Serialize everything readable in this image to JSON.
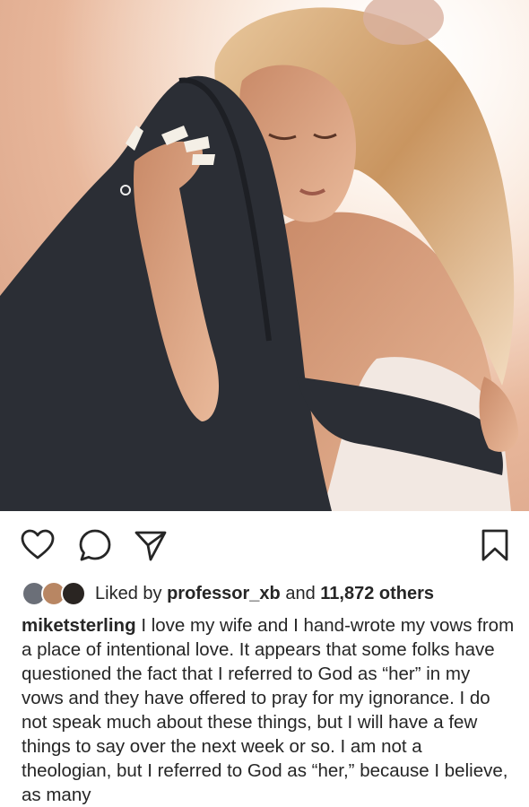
{
  "post": {
    "image_alt": "couple embracing",
    "liked_by_prefix": "Liked by",
    "liked_by_user": "professor_xb",
    "liked_by_and": "and",
    "liked_by_count": "11,872 others",
    "caption_username": "miketsterling",
    "caption_text": "I love my wife and I hand-wrote my vows from a place of intentional love. It appears that some folks have questioned the fact that I referred to God as “her” in my vows and they have offered to pray for my ignorance. I do not speak much about these things, but I will have a few things to say over the next week or so. I am not a theologian, but I referred to God as “her,” because I believe, as many"
  },
  "icons": {
    "like": "heart-icon",
    "comment": "comment-bubble-icon",
    "share": "paper-plane-icon",
    "save": "bookmark-icon"
  }
}
